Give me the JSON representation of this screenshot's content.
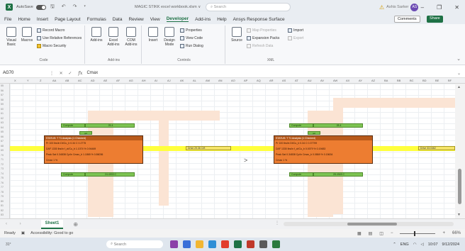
{
  "window": {
    "autosave_label": "AutoSave",
    "doc_title": "MAGIC STIKK excel workbook.xlsm  ∨",
    "search_placeholder": "Search",
    "user_name": "Ashis Sarker",
    "user_initials": "AS"
  },
  "menu": {
    "items": [
      "File",
      "Home",
      "Insert",
      "Page Layout",
      "Formulas",
      "Data",
      "Review",
      "View",
      "Developer",
      "Add-ins",
      "Help",
      "Ansys Response Surface"
    ],
    "active": "Developer",
    "comments": "Comments",
    "share": "Share"
  },
  "ribbon": {
    "code": {
      "label": "Code",
      "visual_basic": "Visual Basic",
      "macros": "Macros",
      "record_macro": "Record Macro",
      "relative_refs": "Use Relative References",
      "macro_security": "Macro Security"
    },
    "addins": {
      "label": "Add-ins",
      "add_ins": "Add-ins",
      "excel_add_ins": "Excel Add-ins",
      "com_add_ins": "COM Add-ins"
    },
    "controls": {
      "label": "Controls",
      "insert": "Insert",
      "design_mode": "Design Mode",
      "properties": "Properties",
      "view_code": "View Code",
      "run_dialog": "Run Dialog"
    },
    "xml": {
      "label": "XML",
      "source": "Source",
      "map_properties": "Map Properties",
      "expansion_packs": "Expansion Packs",
      "refresh_data": "Refresh Data",
      "import": "Import",
      "export": "Export"
    }
  },
  "formula_bar": {
    "name_box": "AG70",
    "fx": "fx",
    "formula": "Cmax"
  },
  "columns": [
    "X",
    "Y",
    "Z",
    "AA",
    "AB",
    "AC",
    "AD",
    "AE",
    "AF",
    "AG",
    "AH",
    "AI",
    "AJ",
    "AK",
    "AL",
    "AM",
    "AN",
    "AO",
    "AP",
    "AQ",
    "AR",
    "AS",
    "AT",
    "AU",
    "AV",
    "AW",
    "AX",
    "AY",
    "AZ",
    "BA",
    "BB",
    "BC",
    "BD",
    "BE",
    "BF"
  ],
  "rows": [
    "55",
    "56",
    "57",
    "58",
    "59",
    "60",
    "61",
    "62",
    "63",
    "64",
    "65",
    "66",
    "67",
    "68",
    "69",
    "70",
    "71",
    "72",
    "73",
    "74",
    "75",
    "76",
    "77",
    "78",
    "79",
    "80",
    "81",
    "82",
    "83"
  ],
  "sheet": {
    "left_block": {
      "top_green": "Compute",
      "top_green_val": "25.4",
      "mini_label": "get",
      "header": "STATUS: T     T1 Analysis (1 Checked)",
      "rows": [
        "Pr        100 lbs/in    Dt/Cu_b      0.34 C        0.2775",
        "DAF       1330 lbs/in   f_ct/Cu_b    1.1074 %      0.94469",
        "Peak Sat  0.34838 Cp/in Cmax_b       1.1865 %      0.86036",
        "                        Cmax         1 %"
      ],
      "bottom_green": "Compute",
      "bottom_green_val": "24.4933 C",
      "yellow_cell": "Drive    29.36 C/ft"
    },
    "right_block": {
      "top_green": "Compute",
      "top_green_val": "28.4",
      "mini_label": "get",
      "header": "STATUS: T     T1 Analysis (1 Checked)",
      "rows": [
        "Pr        100 lbs/in    Dt/Cu_b      0.34 C        0.37799",
        "DAF       1330 lbs/in   f_ct/Cu_b    0.0079 %      0.19483",
        "Peak Sat  0.34838 Cp/in Cmax_b       0.0869 %      0.15634",
        "                        Cmax         1 %"
      ],
      "bottom_green": "Compute",
      "bottom_green_val": "28.4945 C",
      "yellow_cell": "Drive    33.0462"
    }
  },
  "tabs": {
    "sheet_name": "Sheet1"
  },
  "status": {
    "ready": "Ready",
    "accessibility": "Accessibility: Good to go",
    "zoom": "66%"
  },
  "taskbar": {
    "weather": "31°",
    "search": "Search",
    "lang": "ENG",
    "time": "10:07",
    "date": "9/12/2024"
  },
  "colors": {
    "accent": "#1e7145",
    "orange_block": "#ed7d31",
    "green_cell": "#7dc353",
    "yellow_band": "#ffff3c"
  }
}
